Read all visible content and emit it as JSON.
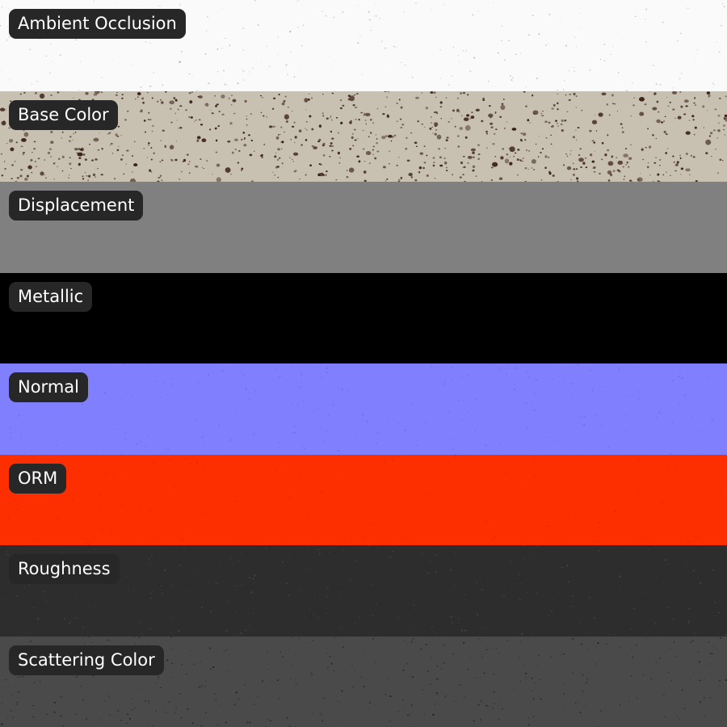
{
  "sheet": {
    "maps": [
      {
        "label": "Ambient Occlusion",
        "texture": "light-speckle",
        "base": "#fafafa",
        "speck": "#b8b8b8",
        "speck_density": 0.25
      },
      {
        "label": "Base Color",
        "texture": "terrazzo-speckle",
        "base": "#c8c0b0",
        "speck": "#3a1f17",
        "speck_density": 1.0
      },
      {
        "label": "Displacement",
        "texture": "flat",
        "base": "#808080",
        "speck": "#777777",
        "speck_density": 0.0
      },
      {
        "label": "Metallic",
        "texture": "flat",
        "base": "#000000",
        "speck": "#000000",
        "speck_density": 0.0
      },
      {
        "label": "Normal",
        "texture": "bumpy-speckle",
        "base": "#8080fe",
        "speck": "#6e6ee0",
        "speck_density": 0.35
      },
      {
        "label": "ORM",
        "texture": "fine-speckle",
        "base": "#fd2e00",
        "speck": "#e22800",
        "speck_density": 0.3
      },
      {
        "label": "Roughness",
        "texture": "fine-speckle",
        "base": "#2d2d2d",
        "speck": "#474747",
        "speck_density": 0.35
      },
      {
        "label": "Scattering Color",
        "texture": "dark-speckle",
        "base": "#4a4a4a",
        "speck": "#222222",
        "speck_density": 0.45
      }
    ]
  }
}
